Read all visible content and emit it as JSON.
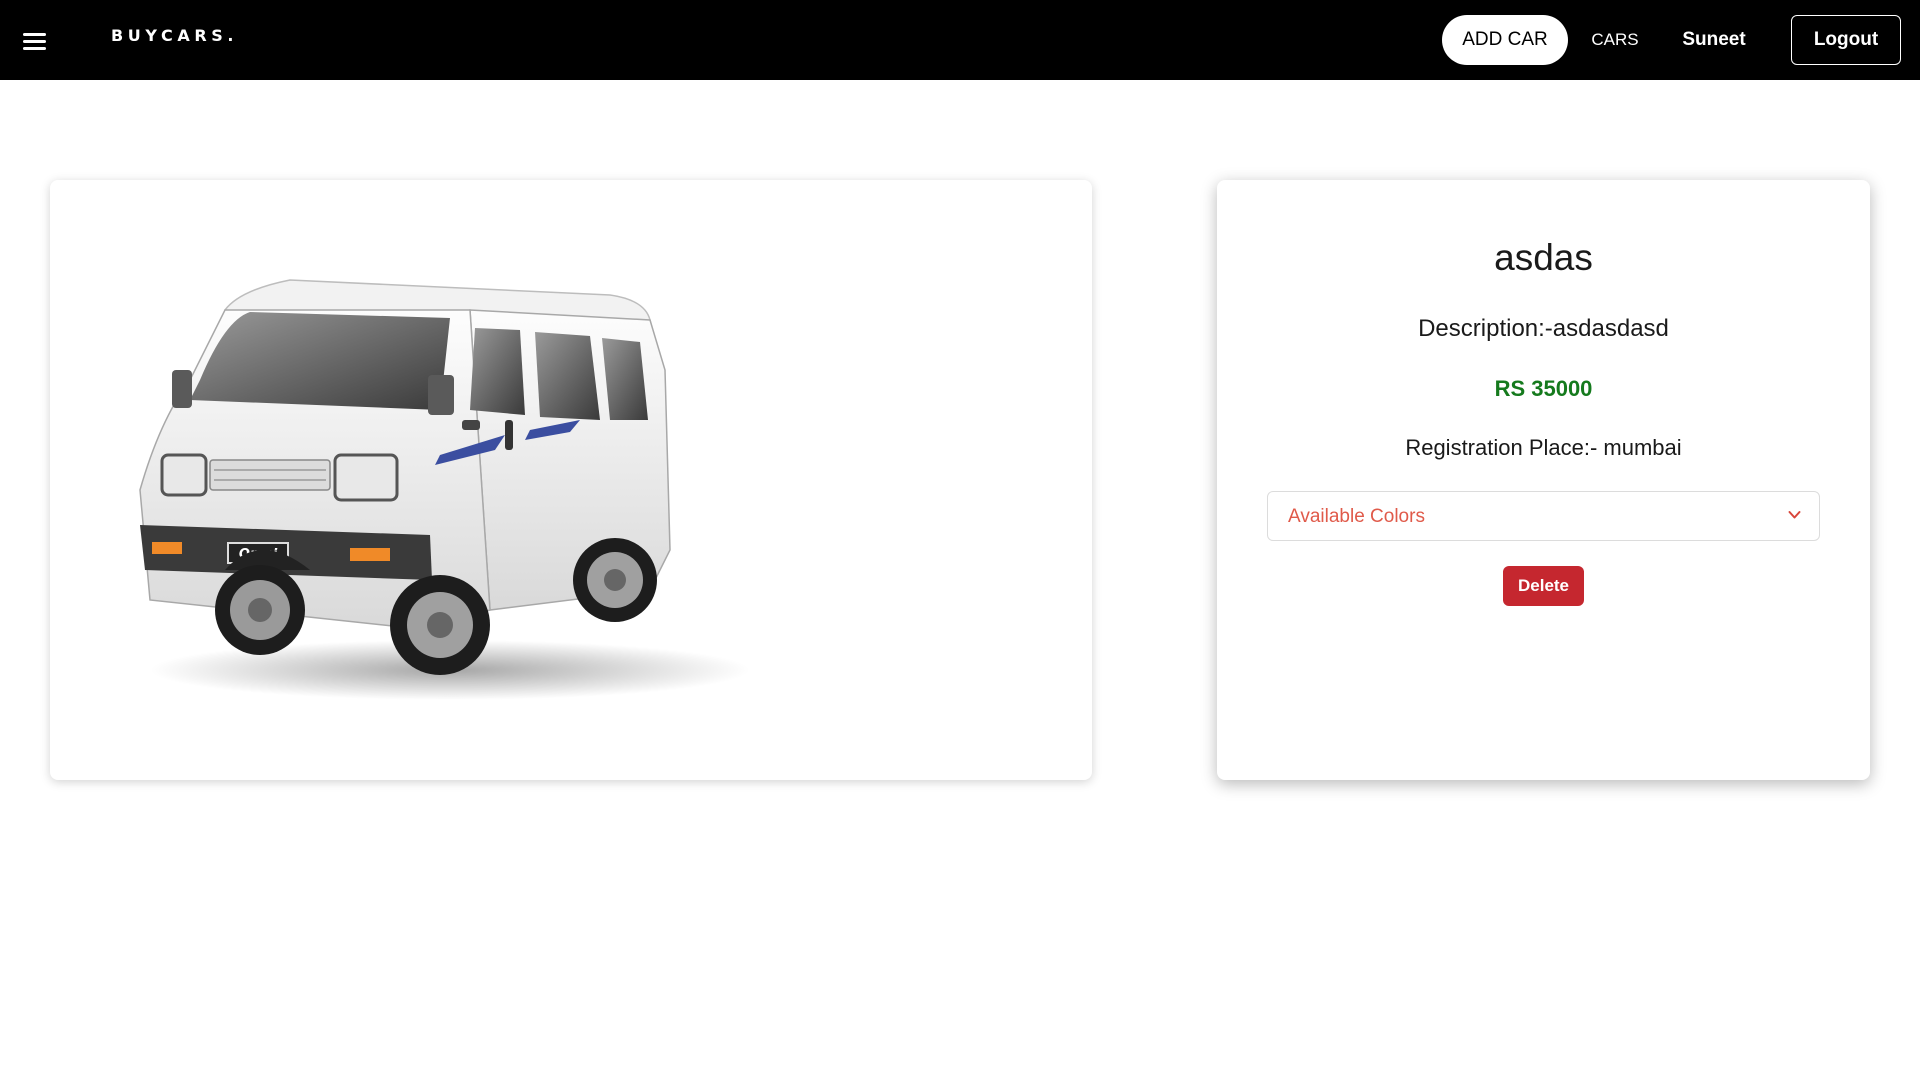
{
  "navbar": {
    "menu_icon": "hamburger-menu-icon",
    "brand": "BUYCARS.",
    "add_car_label": "ADD CAR",
    "cars_label": "CARS",
    "user_name": "Suneet",
    "logout_label": "Logout"
  },
  "car": {
    "image_icon": "van-photo",
    "image_badge": "Omni",
    "title": "asdas",
    "description": "Description:-asdasdasd",
    "price": "RS 35000",
    "registration": "Registration Place:- mumbai",
    "colors_placeholder": "Available Colors",
    "colors_icon": "chevron-down-icon",
    "delete_label": "Delete"
  },
  "colors": {
    "price_green": "#157a1d",
    "placeholder_red": "#e05a4a",
    "delete_red": "#c5272f",
    "navbar_bg": "#000000"
  }
}
